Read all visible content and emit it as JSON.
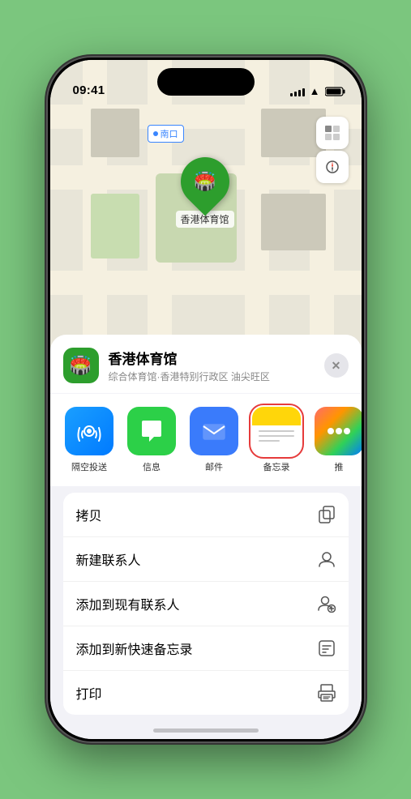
{
  "statusBar": {
    "time": "09:41",
    "locationArrow": "▶"
  },
  "map": {
    "labelText": "南口",
    "locationName": "香港体育馆",
    "locationIcon": "🏟️"
  },
  "sheet": {
    "venueName": "香港体育馆",
    "venueSubtitle": "综合体育馆·香港特别行政区 油尖旺区",
    "closeLabel": "✕"
  },
  "shareItems": [
    {
      "id": "airdrop",
      "label": "隔空投送",
      "emoji": "📡"
    },
    {
      "id": "messages",
      "label": "信息",
      "emoji": "💬"
    },
    {
      "id": "mail",
      "label": "邮件",
      "emoji": "✉️"
    },
    {
      "id": "notes",
      "label": "备忘录",
      "emoji": ""
    },
    {
      "id": "more",
      "label": "推",
      "emoji": "···"
    }
  ],
  "actions": [
    {
      "id": "copy",
      "label": "拷贝",
      "icon": "⧉"
    },
    {
      "id": "new-contact",
      "label": "新建联系人",
      "icon": "👤"
    },
    {
      "id": "add-existing",
      "label": "添加到现有联系人",
      "icon": "👤+"
    },
    {
      "id": "add-quick-note",
      "label": "添加到新快速备忘录",
      "icon": "📋"
    },
    {
      "id": "print",
      "label": "打印",
      "icon": "🖨"
    }
  ]
}
